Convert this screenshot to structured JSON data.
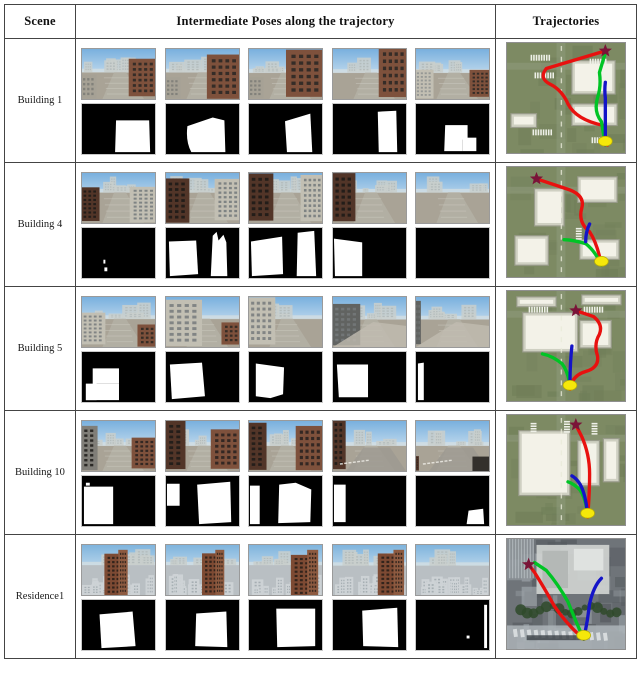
{
  "figure": {
    "columns": [
      {
        "key": "scene",
        "label": "Scene"
      },
      {
        "key": "poses",
        "label": "Intermediate Poses along the trajectory"
      },
      {
        "key": "trajectories",
        "label": "Trajectories"
      }
    ]
  },
  "rows": [
    {
      "scene": "Building 1",
      "poses": [
        {
          "view": "street corner with tall brick apartment block on right",
          "mask": "building silhouette, right-of-center block"
        },
        {
          "view": "brick apartment block seen from lower left, crossing in foreground",
          "mask": "large rounded silhouette, center-right"
        },
        {
          "view": "brick facade filling right half, plaza at left",
          "mask": "tall slab silhouette on right"
        },
        {
          "view": "close pass along dark brick facade, tower at right edge",
          "mask": "narrow vertical silhouette, right"
        },
        {
          "view": "wide plaza, pale tower left, brick block right",
          "mask": "small block silhouette with notch, center"
        }
      ],
      "trajectory": {
        "basemap": "synthetic-aerial-green",
        "paths": [
          {
            "color": "#e8110f",
            "name": "red-trajectory"
          },
          {
            "color": "#00c425",
            "name": "green-trajectory"
          },
          {
            "color": "#1414c8",
            "name": "blue-trajectory"
          }
        ],
        "start_marker": {
          "shape": "ellipse",
          "color": "#f5e80a"
        },
        "goal_marker": {
          "shape": "star",
          "color": "#7a1438"
        }
      }
    },
    {
      "scene": "Building 4",
      "poses": [
        {
          "view": "dark brick block left, pale high-rise right",
          "mask": "almost empty, two small specks"
        },
        {
          "view": "brick block left, pale tower right, street between",
          "mask": "two silhouettes left and right"
        },
        {
          "view": "dark facade left, pale facade right, sky between",
          "mask": "two tall silhouettes"
        },
        {
          "view": "dark brick facade at left edge, open sky",
          "mask": "single left silhouette"
        },
        {
          "view": "empty sky over flat ground plane",
          "mask": "fully empty"
        }
      ],
      "trajectory": {
        "basemap": "synthetic-aerial-green",
        "paths": [
          {
            "color": "#e8110f",
            "name": "red-trajectory"
          },
          {
            "color": "#00c425",
            "name": "green-trajectory"
          },
          {
            "color": "#1414c8",
            "name": "blue-trajectory"
          }
        ],
        "start_marker": {
          "shape": "ellipse",
          "color": "#f5e80a"
        },
        "goal_marker": {
          "shape": "star",
          "color": "#7a1438"
        }
      }
    },
    {
      "scene": "Building 5",
      "poses": [
        {
          "view": "pale apartment tower center, brick buildings right",
          "mask": "stepped silhouette left-of-center"
        },
        {
          "view": "pale tower fills left, brick block right",
          "mask": "large rounded silhouette left"
        },
        {
          "view": "pale facade left, rooftop in foreground",
          "mask": "tall silhouette left"
        },
        {
          "view": "dark facade left, rooftops and street right",
          "mask": "block silhouette left"
        },
        {
          "view": "wide street view, distant towers",
          "mask": "thin vertical sliver at left edge"
        }
      ],
      "trajectory": {
        "basemap": "synthetic-aerial-green",
        "paths": [
          {
            "color": "#e8110f",
            "name": "red-trajectory"
          },
          {
            "color": "#00c425",
            "name": "green-trajectory"
          },
          {
            "color": "#1414c8",
            "name": "blue-trajectory"
          }
        ],
        "start_marker": {
          "shape": "ellipse",
          "color": "#f5e80a"
        },
        "goal_marker": {
          "shape": "star",
          "color": "#7a1438"
        }
      }
    },
    {
      "scene": "Building 10",
      "poses": [
        {
          "view": "grey block left, red brick building right, bus on street",
          "mask": "large silhouette on left"
        },
        {
          "view": "brick wall left, brick building right across street",
          "mask": "silhouettes both sides"
        },
        {
          "view": "dark wall left, brick building right",
          "mask": "silhouettes left and right"
        },
        {
          "view": "dark brick column left, crosswalk ahead",
          "mask": "narrow left silhouette"
        },
        {
          "view": "open intersection with crosswalk, dark bus right",
          "mask": "small silhouette lower right"
        }
      ],
      "trajectory": {
        "basemap": "synthetic-aerial-green",
        "paths": [
          {
            "color": "#e8110f",
            "name": "red-trajectory"
          },
          {
            "color": "#00c425",
            "name": "green-trajectory"
          },
          {
            "color": "#1414c8",
            "name": "blue-trajectory"
          }
        ],
        "start_marker": {
          "shape": "ellipse",
          "color": "#f5e80a"
        },
        "goal_marker": {
          "shape": "star",
          "color": "#7a1438"
        }
      }
    },
    {
      "scene": "Residence1",
      "poses": [
        {
          "view": "brick residential towers over dense white city",
          "mask": "broad silhouette center"
        },
        {
          "view": "brick towers right of center, city below",
          "mask": "silhouette right-of-center"
        },
        {
          "view": "brick tower fills right half",
          "mask": "large silhouette right"
        },
        {
          "view": "close brick facade right, rooftops left",
          "mask": "silhouette right"
        },
        {
          "view": "rooftops and distant skyline, building out of frame",
          "mask": "nearly empty, edge sliver"
        }
      ],
      "trajectory": {
        "basemap": "satellite-photo-urban",
        "paths": [
          {
            "color": "#e8110f",
            "name": "red-trajectory"
          },
          {
            "color": "#00c425",
            "name": "green-trajectory"
          },
          {
            "color": "#1414c8",
            "name": "blue-trajectory"
          }
        ],
        "start_marker": {
          "shape": "ellipse",
          "color": "#f5e80a"
        },
        "goal_marker": {
          "shape": "star",
          "color": "#7a1438"
        }
      }
    }
  ],
  "legend": {
    "red": "#e8110f",
    "green": "#00c425",
    "blue": "#1414c8",
    "start": "#f5e80a",
    "goal": "#7a1438"
  }
}
